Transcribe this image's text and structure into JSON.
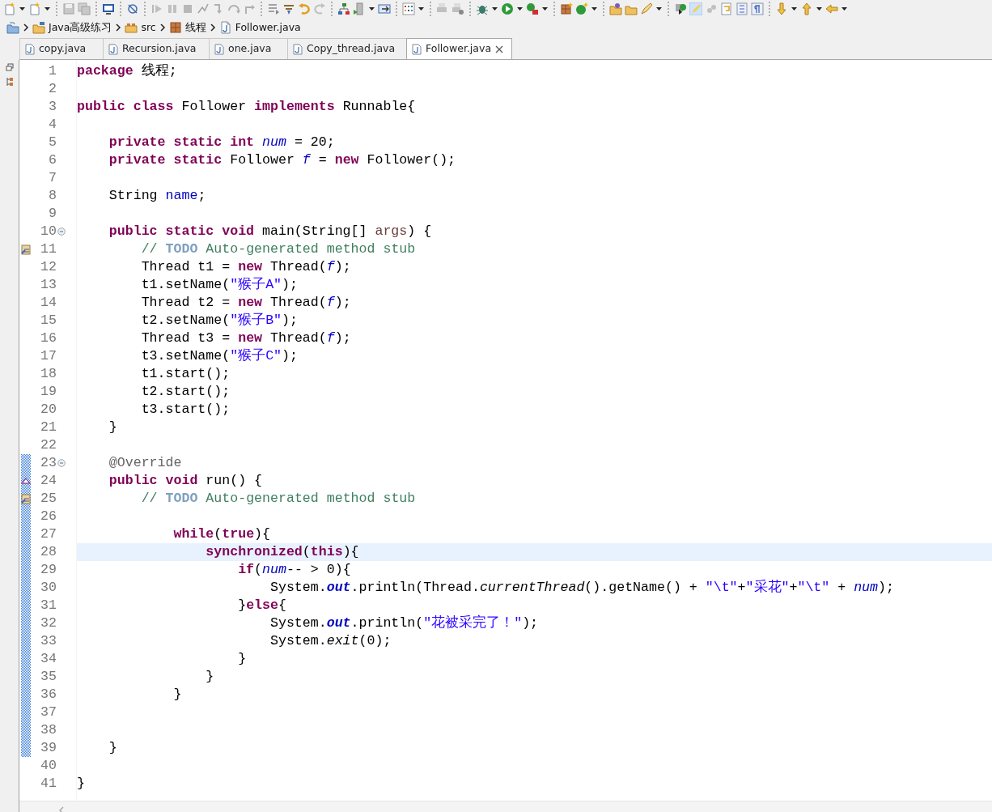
{
  "breadcrumb": [
    {
      "kind": "workspace"
    },
    {
      "kind": "project",
      "label": "Java高级练习"
    },
    {
      "kind": "source-folder",
      "label": "src"
    },
    {
      "kind": "package",
      "label": "线程"
    },
    {
      "kind": "java-file",
      "label": "Follower.java"
    }
  ],
  "tabs": [
    {
      "label": "copy.java",
      "selected": false
    },
    {
      "label": "Recursion.java",
      "selected": false
    },
    {
      "label": "one.java",
      "selected": false
    },
    {
      "label": "Copy_thread.java",
      "selected": false
    },
    {
      "label": "Follower.java",
      "selected": true
    }
  ],
  "editor": {
    "lines": [
      {
        "number": "1",
        "tokens": [
          {
            "kind": "keyword",
            "text": "package"
          },
          {
            "kind": "plain",
            "text": " 线程;"
          }
        ]
      },
      {
        "number": "2"
      },
      {
        "number": "3",
        "tokens": [
          {
            "kind": "keyword",
            "text": "public class"
          },
          {
            "kind": "plain",
            "text": " Follower "
          },
          {
            "kind": "keyword",
            "text": "implements"
          },
          {
            "kind": "plain",
            "text": " Runnable{"
          }
        ]
      },
      {
        "number": "4"
      },
      {
        "number": "5",
        "tokens": [
          {
            "kind": "keyword",
            "text": "    private static int"
          },
          {
            "kind": "static-field",
            "text": " num"
          },
          {
            "kind": "plain",
            "text": " = 20;"
          }
        ]
      },
      {
        "number": "6",
        "tokens": [
          {
            "kind": "keyword",
            "text": "    private static"
          },
          {
            "kind": "plain",
            "text": " Follower "
          },
          {
            "kind": "static-field",
            "text": "f"
          },
          {
            "kind": "plain",
            "text": " = "
          },
          {
            "kind": "keyword",
            "text": "new"
          },
          {
            "kind": "plain",
            "text": " Follower();"
          }
        ]
      },
      {
        "number": "7"
      },
      {
        "number": "8",
        "tokens": [
          {
            "kind": "plain",
            "text": "    String "
          },
          {
            "kind": "field",
            "text": "name"
          },
          {
            "kind": "plain",
            "text": ";"
          }
        ]
      },
      {
        "number": "9"
      },
      {
        "number": "10",
        "fold": true,
        "tokens": [
          {
            "kind": "keyword",
            "text": "    public static void"
          },
          {
            "kind": "plain",
            "text": " main(String[] "
          },
          {
            "kind": "parameter",
            "text": "args"
          },
          {
            "kind": "plain",
            "text": ") {"
          }
        ]
      },
      {
        "number": "11",
        "task": true,
        "tokens": [
          {
            "kind": "comment",
            "text": "        // "
          },
          {
            "kind": "todo",
            "text": "TODO"
          },
          {
            "kind": "comment",
            "text": " Auto-generated method stub"
          }
        ]
      },
      {
        "number": "12",
        "tokens": [
          {
            "kind": "plain",
            "text": "        Thread t1 = "
          },
          {
            "kind": "keyword",
            "text": "new"
          },
          {
            "kind": "plain",
            "text": " Thread("
          },
          {
            "kind": "static-field",
            "text": "f"
          },
          {
            "kind": "plain",
            "text": ");"
          }
        ]
      },
      {
        "number": "13",
        "tokens": [
          {
            "kind": "plain",
            "text": "        t1.setName("
          },
          {
            "kind": "string",
            "text": "\"猴子A\""
          },
          {
            "kind": "plain",
            "text": ");"
          }
        ]
      },
      {
        "number": "14",
        "tokens": [
          {
            "kind": "plain",
            "text": "        Thread t2 = "
          },
          {
            "kind": "keyword",
            "text": "new"
          },
          {
            "kind": "plain",
            "text": " Thread("
          },
          {
            "kind": "static-field",
            "text": "f"
          },
          {
            "kind": "plain",
            "text": ");"
          }
        ]
      },
      {
        "number": "15",
        "tokens": [
          {
            "kind": "plain",
            "text": "        t2.setName("
          },
          {
            "kind": "string",
            "text": "\"猴子B\""
          },
          {
            "kind": "plain",
            "text": ");"
          }
        ]
      },
      {
        "number": "16",
        "tokens": [
          {
            "kind": "plain",
            "text": "        Thread t3 = "
          },
          {
            "kind": "keyword",
            "text": "new"
          },
          {
            "kind": "plain",
            "text": " Thread("
          },
          {
            "kind": "static-field",
            "text": "f"
          },
          {
            "kind": "plain",
            "text": ");"
          }
        ]
      },
      {
        "number": "17",
        "tokens": [
          {
            "kind": "plain",
            "text": "        t3.setName("
          },
          {
            "kind": "string",
            "text": "\"猴子C\""
          },
          {
            "kind": "plain",
            "text": ");"
          }
        ]
      },
      {
        "number": "18",
        "tokens": [
          {
            "kind": "plain",
            "text": "        t1.start();"
          }
        ]
      },
      {
        "number": "19",
        "tokens": [
          {
            "kind": "plain",
            "text": "        t2.start();"
          }
        ]
      },
      {
        "number": "20",
        "tokens": [
          {
            "kind": "plain",
            "text": "        t3.start();"
          }
        ]
      },
      {
        "number": "21",
        "tokens": [
          {
            "kind": "plain",
            "text": "    }"
          }
        ]
      },
      {
        "number": "22"
      },
      {
        "number": "23",
        "fold": true,
        "changed": true,
        "tokens": [
          {
            "kind": "annotation",
            "text": "    @Override"
          }
        ]
      },
      {
        "number": "24",
        "override": true,
        "changed": true,
        "tokens": [
          {
            "kind": "keyword",
            "text": "    public void"
          },
          {
            "kind": "plain",
            "text": " run() {"
          }
        ]
      },
      {
        "number": "25",
        "task": true,
        "changed": true,
        "tokens": [
          {
            "kind": "comment",
            "text": "        // "
          },
          {
            "kind": "todo",
            "text": "TODO"
          },
          {
            "kind": "comment",
            "text": " Auto-generated method stub"
          }
        ]
      },
      {
        "number": "26",
        "changed": true
      },
      {
        "number": "27",
        "changed": true,
        "tokens": [
          {
            "kind": "keyword",
            "text": "            while"
          },
          {
            "kind": "plain",
            "text": "("
          },
          {
            "kind": "keyword",
            "text": "true"
          },
          {
            "kind": "plain",
            "text": "){"
          }
        ]
      },
      {
        "number": "28",
        "changed": true,
        "current": true,
        "tokens": [
          {
            "kind": "keyword",
            "text": "                synchronized"
          },
          {
            "kind": "plain",
            "text": "("
          },
          {
            "kind": "keyword",
            "text": "this"
          },
          {
            "kind": "plain",
            "text": "){"
          }
        ]
      },
      {
        "number": "29",
        "changed": true,
        "tokens": [
          {
            "kind": "keyword",
            "text": "                    if"
          },
          {
            "kind": "plain",
            "text": "("
          },
          {
            "kind": "static-field",
            "text": "num"
          },
          {
            "kind": "plain",
            "text": "-- > 0){"
          }
        ]
      },
      {
        "number": "30",
        "changed": true,
        "tokens": [
          {
            "kind": "plain",
            "text": "                        System."
          },
          {
            "kind": "static-final",
            "text": "out"
          },
          {
            "kind": "plain",
            "text": ".println(Thread."
          },
          {
            "kind": "static-method",
            "text": "currentThread"
          },
          {
            "kind": "plain",
            "text": "().getName() + "
          },
          {
            "kind": "string",
            "text": "\"\\t\""
          },
          {
            "kind": "plain",
            "text": "+"
          },
          {
            "kind": "string",
            "text": "\"采花\""
          },
          {
            "kind": "plain",
            "text": "+"
          },
          {
            "kind": "string",
            "text": "\"\\t\""
          },
          {
            "kind": "plain",
            "text": " + "
          },
          {
            "kind": "static-field",
            "text": "num"
          },
          {
            "kind": "plain",
            "text": ");"
          }
        ]
      },
      {
        "number": "31",
        "changed": true,
        "tokens": [
          {
            "kind": "plain",
            "text": "                    }"
          },
          {
            "kind": "keyword",
            "text": "else"
          },
          {
            "kind": "plain",
            "text": "{"
          }
        ]
      },
      {
        "number": "32",
        "changed": true,
        "tokens": [
          {
            "kind": "plain",
            "text": "                        System."
          },
          {
            "kind": "static-final",
            "text": "out"
          },
          {
            "kind": "plain",
            "text": ".println("
          },
          {
            "kind": "string",
            "text": "\"花被采完了！\""
          },
          {
            "kind": "plain",
            "text": ");"
          }
        ]
      },
      {
        "number": "33",
        "changed": true,
        "tokens": [
          {
            "kind": "plain",
            "text": "                        System."
          },
          {
            "kind": "static-method",
            "text": "exit"
          },
          {
            "kind": "plain",
            "text": "(0);"
          }
        ]
      },
      {
        "number": "34",
        "changed": true,
        "tokens": [
          {
            "kind": "plain",
            "text": "                    }"
          }
        ]
      },
      {
        "number": "35",
        "changed": true,
        "tokens": [
          {
            "kind": "plain",
            "text": "                }"
          }
        ]
      },
      {
        "number": "36",
        "changed": true,
        "tokens": [
          {
            "kind": "plain",
            "text": "            }"
          }
        ]
      },
      {
        "number": "37",
        "changed": true
      },
      {
        "number": "38",
        "changed": true
      },
      {
        "number": "39",
        "changed": true,
        "tokens": [
          {
            "kind": "plain",
            "text": "    }"
          }
        ]
      },
      {
        "number": "40"
      },
      {
        "number": "41",
        "tokens": [
          {
            "kind": "plain",
            "text": "}"
          }
        ]
      }
    ]
  }
}
